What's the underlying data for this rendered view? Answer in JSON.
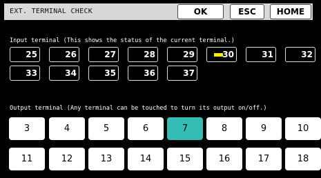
{
  "header": {
    "title": "EXT. TERMINAL CHECK",
    "ok_label": "OK",
    "esc_label": "ESC",
    "home_label": "HOME"
  },
  "input_section": {
    "label": "Input terminal (This shows the status of the current terminal.)",
    "terminals": [
      {
        "number": "25",
        "active": false
      },
      {
        "number": "26",
        "active": false
      },
      {
        "number": "27",
        "active": false
      },
      {
        "number": "28",
        "active": false
      },
      {
        "number": "29",
        "active": false
      },
      {
        "number": "30",
        "active": true
      },
      {
        "number": "31",
        "active": false
      },
      {
        "number": "32",
        "active": false
      },
      {
        "number": "33",
        "active": false
      },
      {
        "number": "34",
        "active": false
      },
      {
        "number": "35",
        "active": false
      },
      {
        "number": "36",
        "active": false
      },
      {
        "number": "37",
        "active": false
      }
    ]
  },
  "output_section": {
    "label": "Output terminal (Any terminal can be touched to turn its output on/off.)",
    "terminals": [
      {
        "number": "3",
        "on": false
      },
      {
        "number": "4",
        "on": false
      },
      {
        "number": "5",
        "on": false
      },
      {
        "number": "6",
        "on": false
      },
      {
        "number": "7",
        "on": true
      },
      {
        "number": "8",
        "on": false
      },
      {
        "number": "9",
        "on": false
      },
      {
        "number": "10",
        "on": false
      },
      {
        "number": "11",
        "on": false
      },
      {
        "number": "12",
        "on": false
      },
      {
        "number": "13",
        "on": false
      },
      {
        "number": "14",
        "on": false
      },
      {
        "number": "15",
        "on": false
      },
      {
        "number": "16",
        "on": false
      },
      {
        "number": "17",
        "on": false
      },
      {
        "number": "18",
        "on": false
      }
    ]
  },
  "colors": {
    "background": "#000000",
    "header_bar": "#d8d8d8",
    "output_on": "#33bdb4",
    "input_active_indicator": "#ffee00"
  }
}
